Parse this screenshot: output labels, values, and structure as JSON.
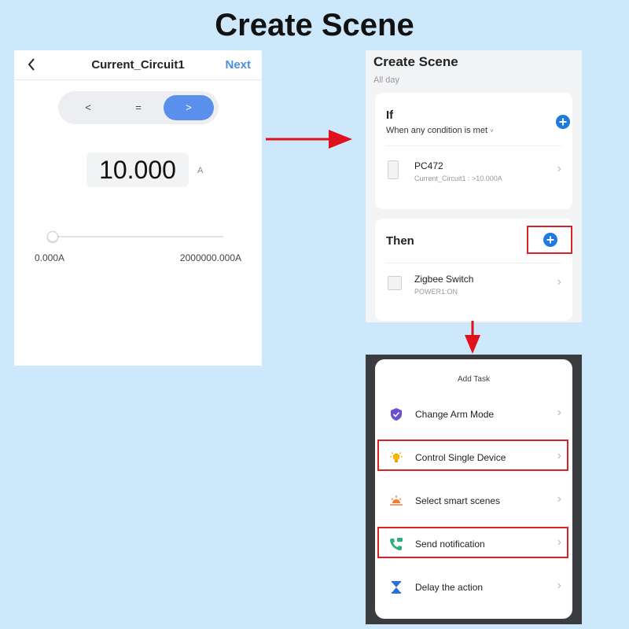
{
  "page_title": "Create Scene",
  "condition_editor": {
    "back_icon": "chevron-left-icon",
    "title": "Current_Circuit1",
    "next_label": "Next",
    "operators": [
      "<",
      "=",
      ">"
    ],
    "selected_operator": ">",
    "value": "10.000",
    "unit": "A",
    "slider_min_label": "0.000A",
    "slider_max_label": "2000000.000A",
    "slider_position": 0
  },
  "scene": {
    "title": "Create Scene",
    "subtitle": "All day",
    "if_section": {
      "heading": "If",
      "condition_mode": "When any condition is met",
      "caret": "˅",
      "device_name": "PC472",
      "device_condition": "Current_Circuit1 : >10.000A"
    },
    "then_section": {
      "heading": "Then",
      "device_name": "Zigbee Switch",
      "device_action": "POWER1:ON"
    },
    "add_icon": "plus-icon",
    "chevron": "›"
  },
  "add_task": {
    "title": "Add Task",
    "items": [
      {
        "label": "Change Arm Mode",
        "icon": "shield-check-icon",
        "highlighted": false
      },
      {
        "label": "Control Single Device",
        "icon": "lightbulb-icon",
        "highlighted": true
      },
      {
        "label": "Select smart scenes",
        "icon": "sunrise-icon",
        "highlighted": false
      },
      {
        "label": "Send notification",
        "icon": "phone-message-icon",
        "highlighted": true
      },
      {
        "label": "Delay the action",
        "icon": "hourglass-icon",
        "highlighted": false
      }
    ],
    "chevron": "›"
  },
  "colors": {
    "background": "#cde7fb",
    "accent_blue": "#1f7ae0",
    "segment_active": "#5b8fec",
    "highlight_red": "#d9212a",
    "next_blue": "#4a90e2"
  }
}
